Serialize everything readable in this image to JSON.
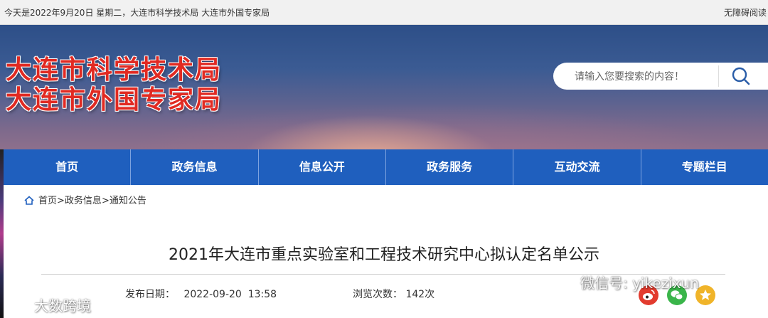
{
  "topbar": {
    "date_text": "今天是2022年9月20日 星期二，大连市科学技术局 大连市外国专家局",
    "accessibility": "无障碍阅读"
  },
  "brand": {
    "line1": "大连市科学技术局",
    "line2": "大连市外国专家局",
    "color": "#e12a22"
  },
  "search": {
    "placeholder": "请输入您要搜索的内容！",
    "icon": "search-icon"
  },
  "nav": {
    "color": "#1f5fbe",
    "items": [
      "首页",
      "政务信息",
      "信息公开",
      "政务服务",
      "互动交流",
      "专题栏目"
    ]
  },
  "breadcrumb": {
    "icon": "home-icon",
    "home": "首页",
    "sep": ">",
    "level1": "政务信息",
    "level2": "通知公告"
  },
  "article": {
    "title": "2021年大连市重点实验室和工程技术研究中心拟认定名单公示",
    "publish_label": "发布日期：",
    "publish_value": "2022-09-20  13:58",
    "views_label": "浏览次数：",
    "views_value": "142次"
  },
  "watermarks": {
    "left": "大数跨境",
    "right": "微信号: yikezixun"
  },
  "share": {
    "icons": [
      "weibo-icon",
      "wechat-icon",
      "star-icon"
    ],
    "colors": [
      "#e23b2e",
      "#3ab54a",
      "#f0b429"
    ]
  }
}
